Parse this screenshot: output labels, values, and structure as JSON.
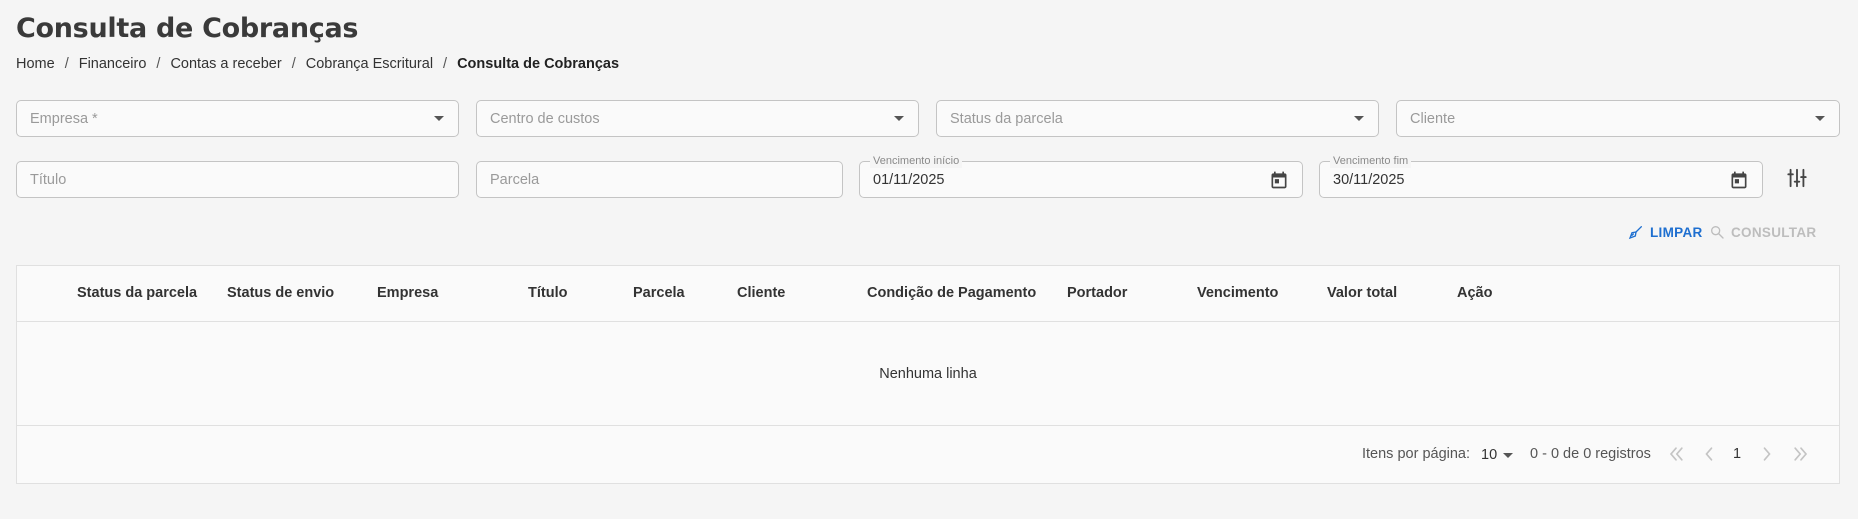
{
  "page": {
    "title": "Consulta de Cobranças"
  },
  "breadcrumb": [
    "Home",
    "Financeiro",
    "Contas a receber",
    "Cobrança Escritural",
    "Consulta de Cobranças"
  ],
  "filters": {
    "empresa": {
      "placeholder": "Empresa *"
    },
    "centro_custos": {
      "placeholder": "Centro de custos"
    },
    "status_parcela": {
      "placeholder": "Status da parcela"
    },
    "cliente": {
      "placeholder": "Cliente"
    },
    "titulo": {
      "placeholder": "Título"
    },
    "parcela": {
      "placeholder": "Parcela"
    },
    "vencimento_inicio": {
      "label": "Vencimento início",
      "value": "01/11/2025"
    },
    "vencimento_fim": {
      "label": "Vencimento fim",
      "value": "30/11/2025"
    }
  },
  "actions": {
    "limpar": "LIMPAR",
    "consultar": "CONSULTAR"
  },
  "table": {
    "columns": [
      "Status da parcela",
      "Status de envio",
      "Empresa",
      "Título",
      "Parcela",
      "Cliente",
      "Condição de Pagamento",
      "Portador",
      "Vencimento",
      "Valor total",
      "Ação"
    ],
    "empty_text": "Nenhuma linha"
  },
  "pagination": {
    "items_label": "Itens por página:",
    "page_size": "10",
    "range": "0 - 0 de 0 registros",
    "current_page": "1"
  },
  "colors": {
    "accent": "#1e6fd0",
    "disabled": "#bdbdbd"
  },
  "icons": [
    "chevron-down-icon",
    "calendar-icon",
    "filter-settings-icon",
    "broom-icon",
    "search-icon",
    "first-page-icon",
    "prev-page-icon",
    "next-page-icon",
    "last-page-icon"
  ]
}
